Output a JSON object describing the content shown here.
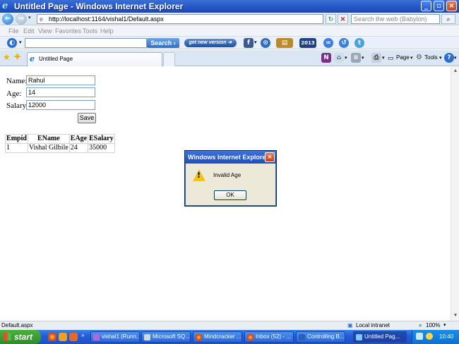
{
  "window": {
    "title": "Untitled Page - Windows Internet Explorer"
  },
  "address": {
    "url": "http://localhost:1164/vishal1/Default.aspx"
  },
  "websearch": {
    "placeholder": "Search the web (Babylon)"
  },
  "menu": [
    "File",
    "Edit",
    "View",
    "Favorites",
    "Tools",
    "Help"
  ],
  "babylon": {
    "search_label": "Search",
    "get_new_version": "get new version",
    "year_badge": "2013"
  },
  "tabs": [
    {
      "label": "Untitled Page"
    }
  ],
  "commandbar": {
    "page_label": "Page",
    "tools_label": "Tools"
  },
  "form": {
    "name_label": "Name:",
    "name_value": "Rahul",
    "age_label": "Age:",
    "age_value": "14",
    "salary_label": "Salary:",
    "salary_value": "12000",
    "save_label": "Save"
  },
  "grid": {
    "headers": [
      "Empid",
      "EName",
      "EAge",
      "ESalary"
    ],
    "rows": [
      [
        "1",
        "Vishal Gilbile",
        "24",
        "35000"
      ]
    ]
  },
  "dialog": {
    "title": "Windows Internet Explorer",
    "message": "Invalid Age",
    "ok_label": "OK"
  },
  "statusbar": {
    "left": "Default.aspx",
    "zone": "Local intranet",
    "zoom": "100%"
  },
  "taskbar": {
    "start_label": "start",
    "buttons": [
      {
        "label": "vishal1 (Runn..."
      },
      {
        "label": "Microsoft SQ..."
      },
      {
        "label": "Mindcracker ..."
      },
      {
        "label": "Inbox (52) - ..."
      },
      {
        "label": "Controlling B..."
      },
      {
        "label": "Untitled Pag..."
      }
    ],
    "clock": "10:40"
  }
}
